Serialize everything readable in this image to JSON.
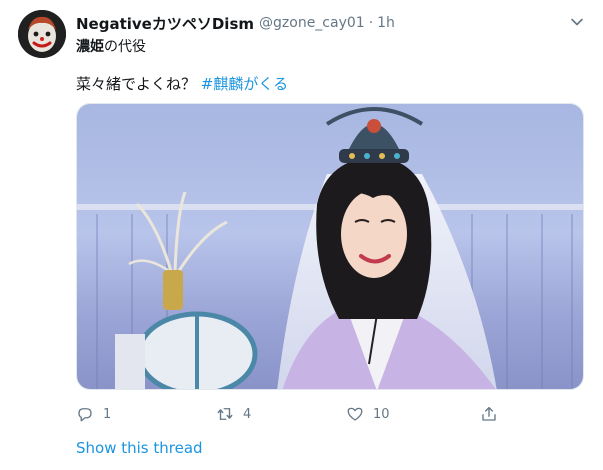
{
  "author": {
    "display_name": "NegativeカツペソDism",
    "handle": "@gzone_cay01",
    "separator": "·",
    "time": "1h"
  },
  "bio": {
    "bold": "濃姫",
    "rest": "の代役"
  },
  "tweet": {
    "text": "菜々緒でよくね？",
    "hashtag": "#麒麟がくる"
  },
  "actions": {
    "replies": "1",
    "retweets": "4",
    "likes": "10"
  },
  "thread_link": "Show this thread",
  "icons": {
    "avatar": "clown-avatar",
    "menu": "chevron-down-icon",
    "reply": "reply-icon",
    "retweet": "retweet-icon",
    "like": "heart-icon",
    "share": "share-icon"
  },
  "colors": {
    "link": "#1b95e0",
    "text": "#14171a",
    "muted": "#657786",
    "border": "#e1e8ed"
  }
}
